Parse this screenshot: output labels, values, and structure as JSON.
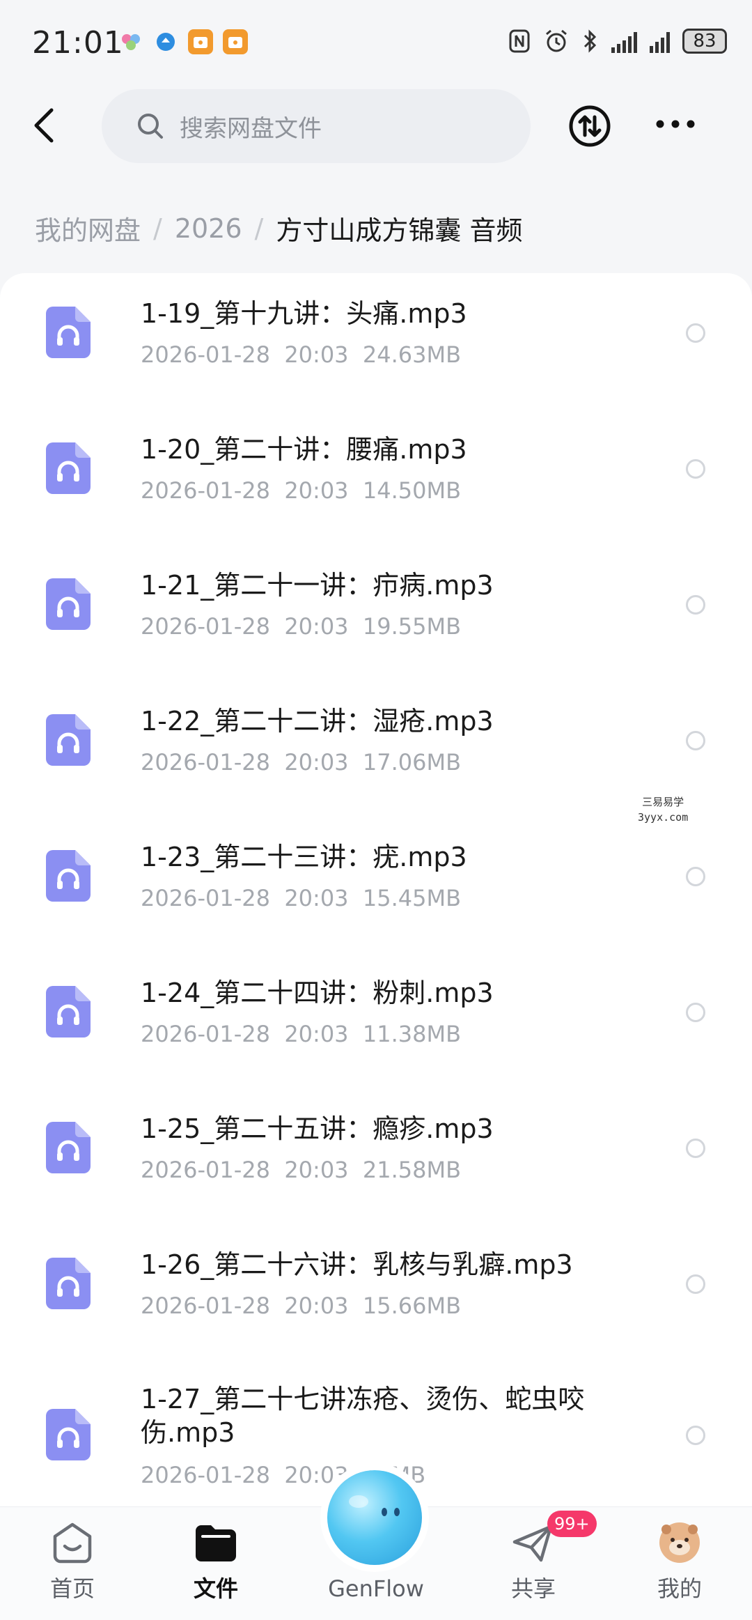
{
  "status_bar": {
    "time": "21:01",
    "battery": "83",
    "icons": [
      "nfc-icon",
      "alarm-icon",
      "bluetooth-icon",
      "signal-icon",
      "signal-icon"
    ]
  },
  "header": {
    "search_placeholder": "搜索网盘文件",
    "icons": [
      "back-arrow-icon",
      "search-icon",
      "transfer-icon",
      "more-icon"
    ]
  },
  "breadcrumb": {
    "items": [
      "我的网盘",
      "2026",
      "方寸山成方锦囊 音频"
    ],
    "separator": "/"
  },
  "files": [
    {
      "name": "1-19_第十九讲：头痛.mp3",
      "date": "2026-01-28",
      "time": "20:03",
      "size": "24.63MB"
    },
    {
      "name": "1-20_第二十讲：腰痛.mp3",
      "date": "2026-01-28",
      "time": "20:03",
      "size": "14.50MB"
    },
    {
      "name": "1-21_第二十一讲：疖病.mp3",
      "date": "2026-01-28",
      "time": "20:03",
      "size": "19.55MB"
    },
    {
      "name": "1-22_第二十二讲：湿疮.mp3",
      "date": "2026-01-28",
      "time": "20:03",
      "size": "17.06MB"
    },
    {
      "name": "1-23_第二十三讲：疣.mp3",
      "date": "2026-01-28",
      "time": "20:03",
      "size": "15.45MB"
    },
    {
      "name": "1-24_第二十四讲：粉刺.mp3",
      "date": "2026-01-28",
      "time": "20:03",
      "size": "11.38MB"
    },
    {
      "name": "1-25_第二十五讲：瘾疹.mp3",
      "date": "2026-01-28",
      "time": "20:03",
      "size": "21.58MB"
    },
    {
      "name": "1-26_第二十六讲：乳核与乳癖.mp3",
      "date": "2026-01-28",
      "time": "20:03",
      "size": "15.66MB"
    },
    {
      "name": "1-27_第二十七讲冻疮、烫伤、蛇虫咬伤.mp3",
      "date": "2026-01-28",
      "time": "20:03",
      "size": "17MB"
    }
  ],
  "watermark": {
    "line1": "三易易学",
    "line2": "3yyx.com"
  },
  "bottom_nav": {
    "items": [
      {
        "label": "首页",
        "icon": "home-icon"
      },
      {
        "label": "文件",
        "icon": "folder-icon",
        "active": true
      },
      {
        "label": "GenFlow",
        "icon": "genflow-orb-icon"
      },
      {
        "label": "共享",
        "icon": "share-plane-icon",
        "badge": "99+"
      },
      {
        "label": "我的",
        "icon": "avatar-icon"
      }
    ]
  },
  "colors": {
    "accent_icon": "#8b8ff2",
    "badge": "#f5386a",
    "genflow": "#52c7f2"
  }
}
